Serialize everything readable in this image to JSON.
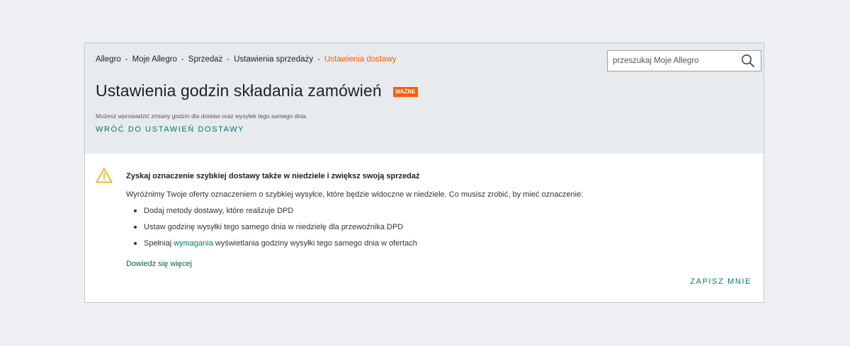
{
  "breadcrumb": {
    "items": [
      "Allegro",
      "Moje Allegro",
      "Sprzedaż",
      "Ustawienia sprzedaży"
    ],
    "separator": "-",
    "current": "Ustawienia dostawy"
  },
  "search": {
    "placeholder": "przeszukaj Moje Allegro",
    "value": "",
    "icon": "search-icon"
  },
  "header": {
    "title": "Ustawienia godzin składania zamówień",
    "badge": "WAŻNE",
    "subtitle": "Możesz wprowadzić zmiany godzin dla dostaw oraz wysyłek tego samego dnia.",
    "back_link": "WRÓĆ DO USTAWIEŃ DOSTAWY"
  },
  "notice": {
    "icon": "warning-icon",
    "title": "Zyskaj oznaczenie szybkiej dostawy także w niedziele i zwiększ swoją sprzedaż",
    "text": "Wyróżnimy Twoje oferty oznaczeniem o szybkiej wysyłce, które będzie widoczne w niedziele. Co musisz zrobić, by mieć oznaczenie:",
    "bullets": [
      "Dodaj metody dostawy, które realizuje DPD",
      "Ustaw godzinę wysyłki tego samego dnia w niedzielę dla przewoźnika DPD"
    ],
    "bullet3": {
      "prefix": "Spełniaj ",
      "link": "wymagania",
      "suffix": " wyświetlania godziny wysyłki tego samego dnia w ofertach"
    },
    "learn_more": "Dowiedz się więcej",
    "subscribe": "ZAPISZ MNIE"
  },
  "colors": {
    "accent": "#00796b",
    "brand_orange": "#ff5a00",
    "header_bg": "#e8ebee",
    "page_bg": "#eef0f3"
  }
}
